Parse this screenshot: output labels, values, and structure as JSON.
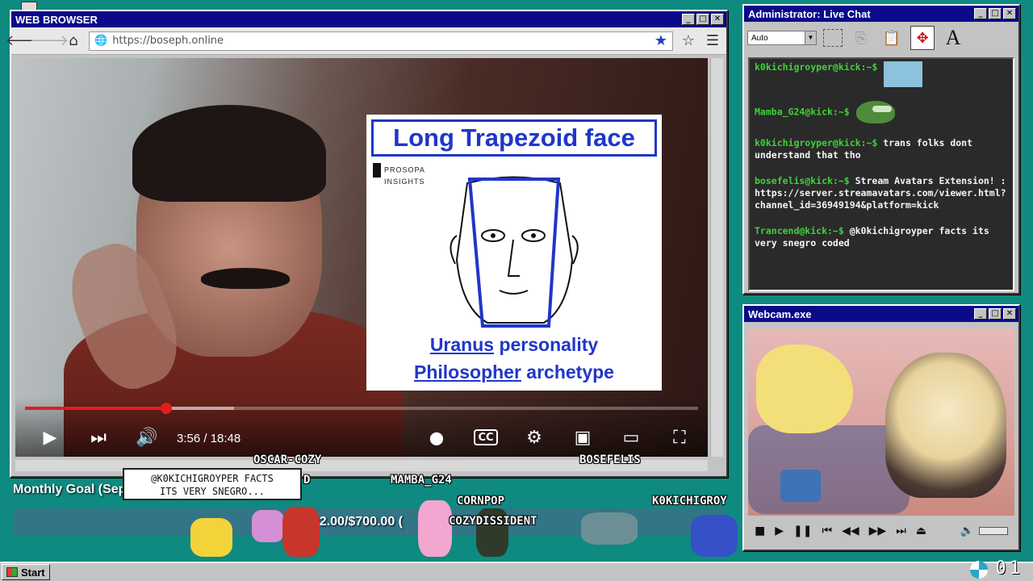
{
  "browser": {
    "title": "WEB BROWSER",
    "url": "https://boseph.online",
    "video": {
      "slide_title": "Long Trapezoid face",
      "slide_brand_line1": "PROSOPA",
      "slide_brand_line2": "INSIGHTS",
      "slide_word1": "Uranus",
      "slide_rest1": " personality",
      "slide_word2": "Philosopher",
      "slide_rest2": " archetype",
      "time": "3:56 / 18:48",
      "progress_played": 0.21,
      "progress_buffered": 0.31
    }
  },
  "chat": {
    "title": "Administrator: Live Chat",
    "select_value": "Auto",
    "messages": [
      {
        "user": "k0kichigroyper@kick:~$",
        "text": "",
        "emote": "blue"
      },
      {
        "user": "Mamba_G24@kick:~$",
        "text": "",
        "emote": "pepe"
      },
      {
        "user": "k0kichigroyper@kick:~$",
        "text": "trans folks dont understand that tho"
      },
      {
        "user": "bosefelis@kick:~$",
        "text": "Stream Avatars Extension! : https://server.streamavatars.com/viewer.html?channel_id=36949194&platform=kick"
      },
      {
        "user": "Trancend@kick:~$",
        "text": "@k0kichigroyper facts its very snegro coded"
      }
    ]
  },
  "webcam": {
    "title": "Webcam.exe"
  },
  "overlay": {
    "goal_label": "Monthly Goal (Sep",
    "goal_amount": "332.00/$700.00 (",
    "speech_bubble_line1": "@K0KICHIGROYPER FACTS",
    "speech_bubble_line2": "ITS VERY SNEGRO...",
    "nicknames": [
      "OSCAR-COZY",
      "D",
      "MAMBA_G24",
      "CORNPOP",
      "COZYDISSIDENT",
      "BOSEFELIS",
      "K0KICHIGROY"
    ]
  },
  "taskbar": {
    "start_label": "Start",
    "clock": "01"
  },
  "colors": {
    "desktop": "#0e8a80",
    "titlebar": "#0a0a8a",
    "chat_user": "#3fd23a",
    "slide_blue": "#2036c9",
    "progress_red": "#e01e1e"
  }
}
